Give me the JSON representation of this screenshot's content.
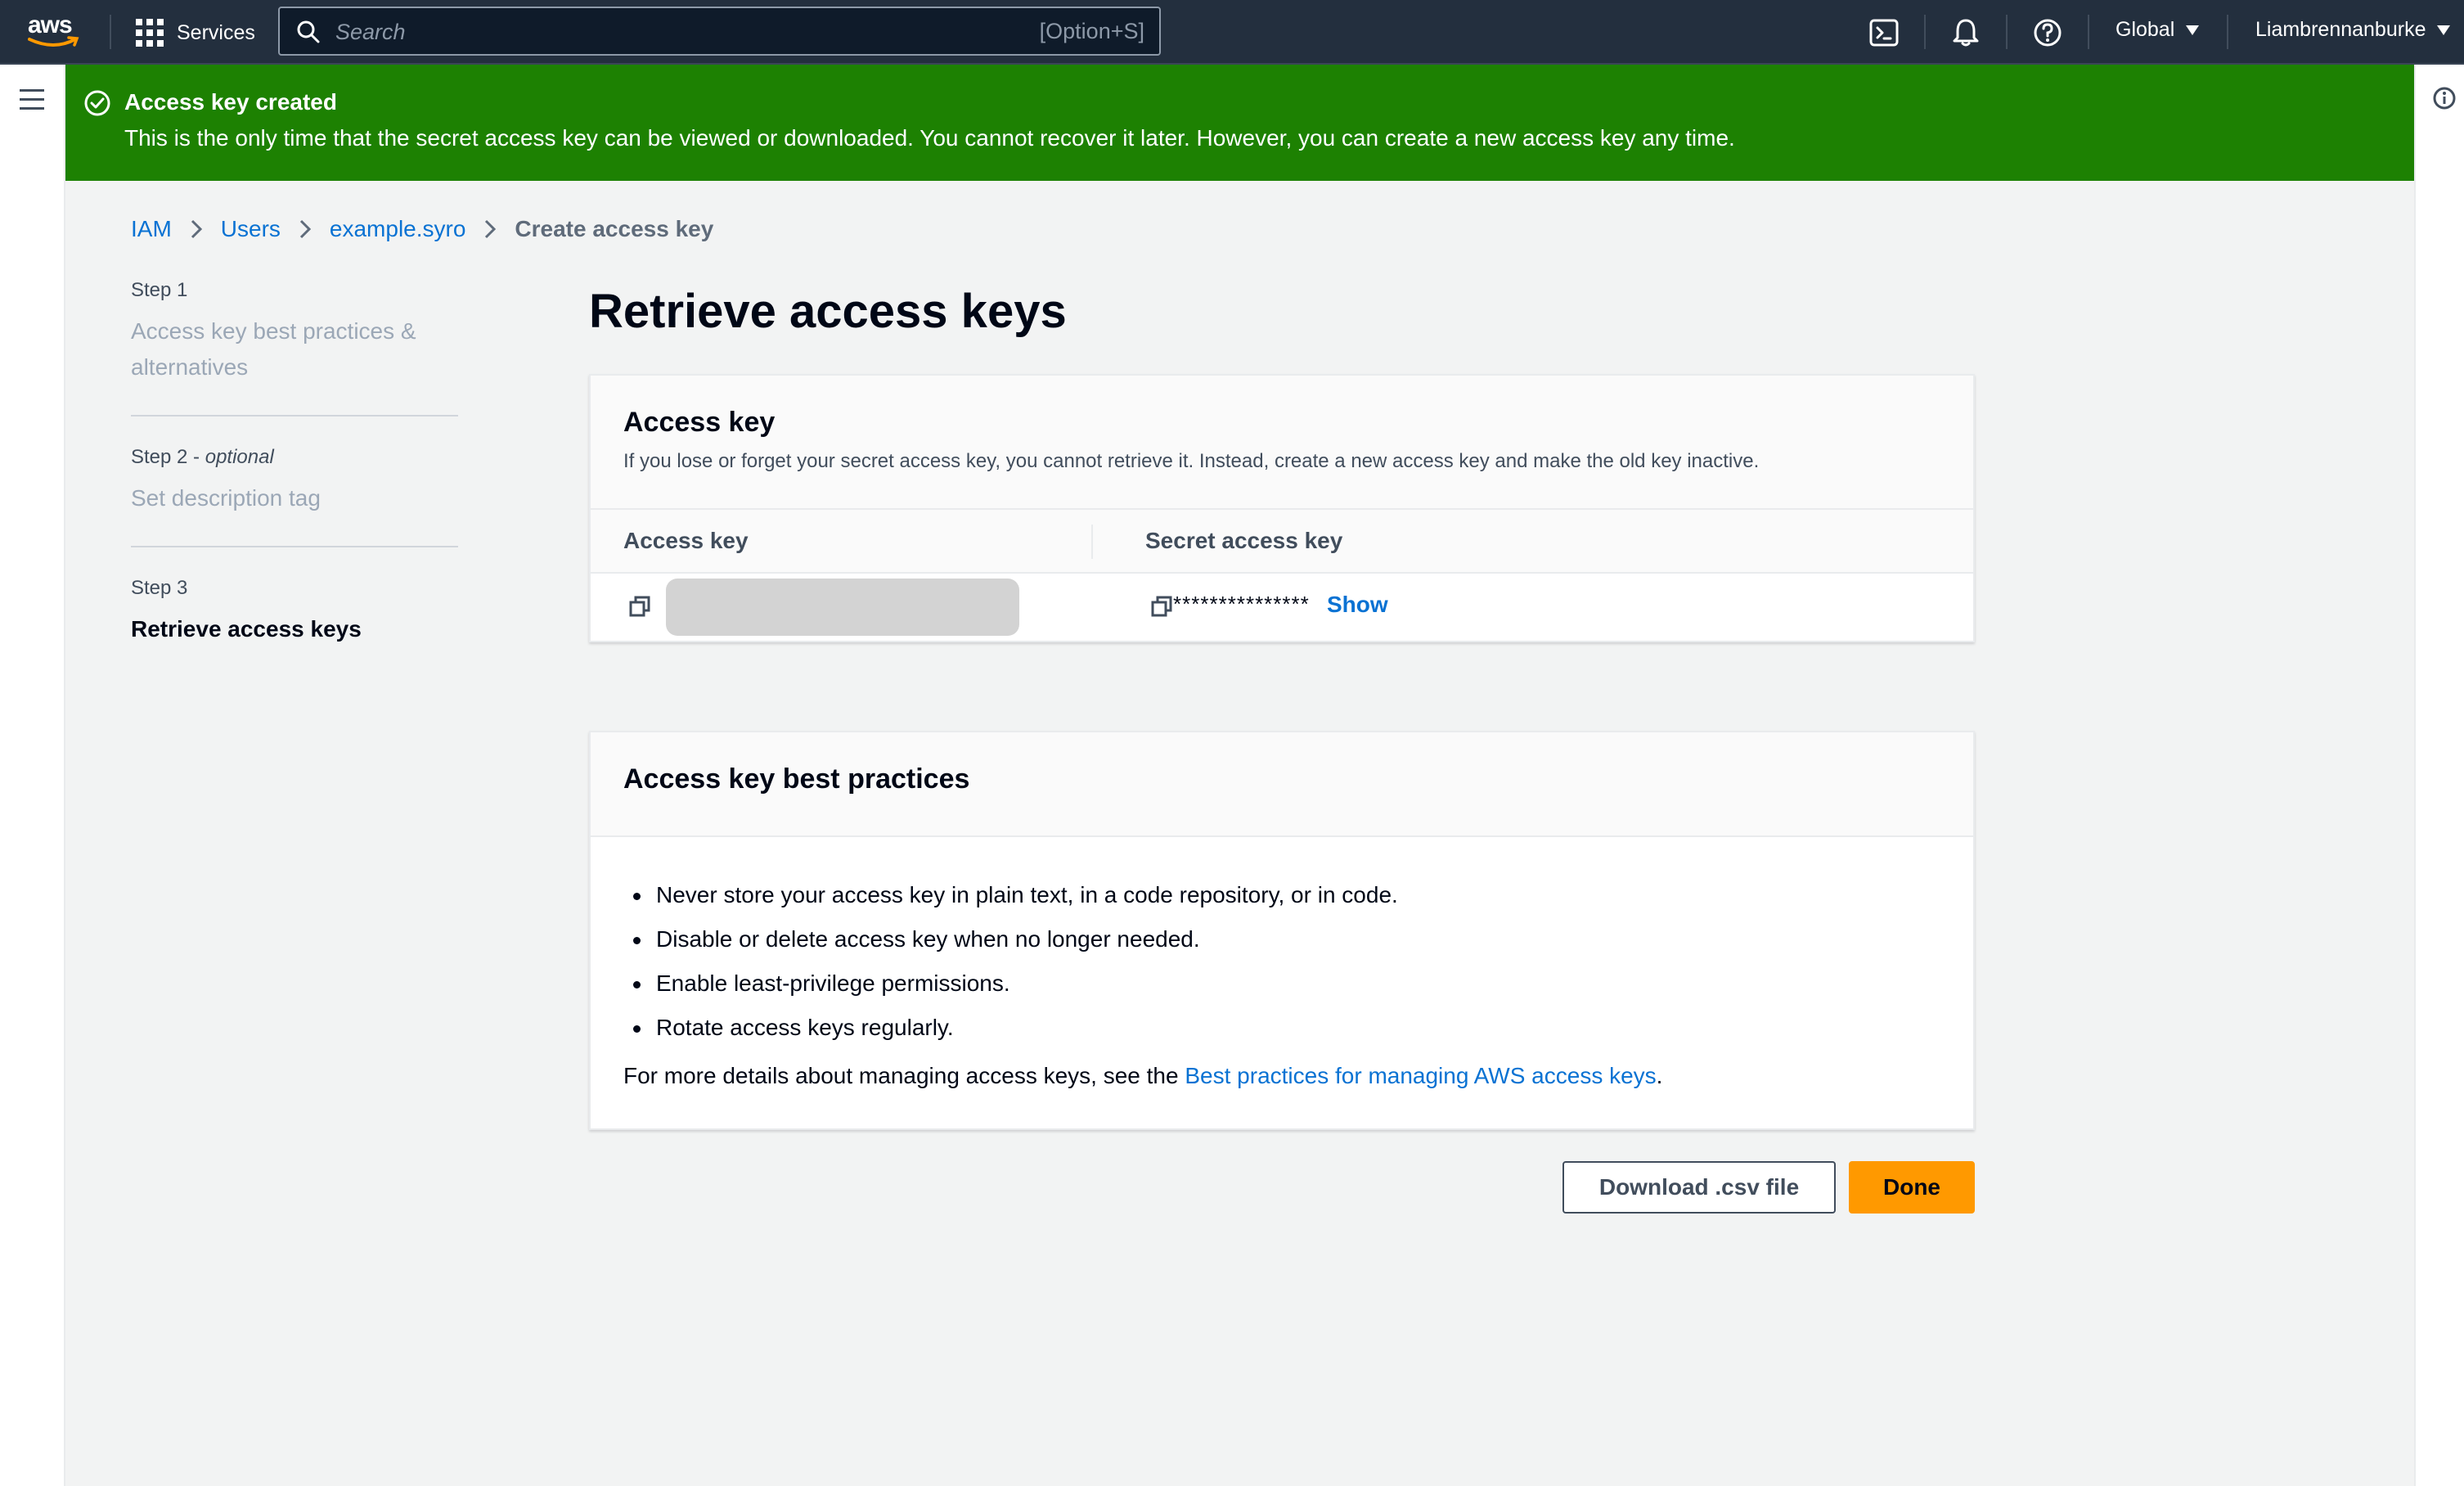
{
  "topnav": {
    "logo_text": "aws",
    "services_label": "Services",
    "search_placeholder": "Search",
    "search_shortcut": "[Option+S]",
    "region": "Global",
    "account": "Liambrennanburke"
  },
  "flash": {
    "title": "Access key created",
    "message": "This is the only time that the secret access key can be viewed or downloaded. You cannot recover it later. However, you can create a new access key any time.",
    "color": "#1d8102"
  },
  "breadcrumb": {
    "items": [
      "IAM",
      "Users",
      "example.syro"
    ],
    "current": "Create access key"
  },
  "steps": [
    {
      "number": "Step 1",
      "optional": "",
      "title": "Access key best practices & alternatives"
    },
    {
      "number": "Step 2",
      "optional": "optional",
      "title": "Set description tag"
    },
    {
      "number": "Step 3",
      "optional": "",
      "title": "Retrieve access keys"
    }
  ],
  "page_title": "Retrieve access keys",
  "access_key_card": {
    "title": "Access key",
    "description": "If you lose or forget your secret access key, you cannot retrieve it. Instead, create a new access key and make the old key inactive.",
    "col_access_key": "Access key",
    "col_secret": "Secret access key",
    "secret_masked": "***************",
    "show_label": "Show"
  },
  "best_practices_card": {
    "title": "Access key best practices",
    "items": [
      "Never store your access key in plain text, in a code repository, or in code.",
      "Disable or delete access key when no longer needed.",
      "Enable least-privilege permissions.",
      "Rotate access keys regularly."
    ],
    "details_prefix": "For more details about managing access keys, see the ",
    "details_link": "Best practices for managing AWS access keys",
    "details_suffix": "."
  },
  "buttons": {
    "download": "Download .csv file",
    "done": "Done"
  },
  "colors": {
    "nav_bg": "#232f3e",
    "link": "#0972d3",
    "primary_button": "#ff9900"
  }
}
